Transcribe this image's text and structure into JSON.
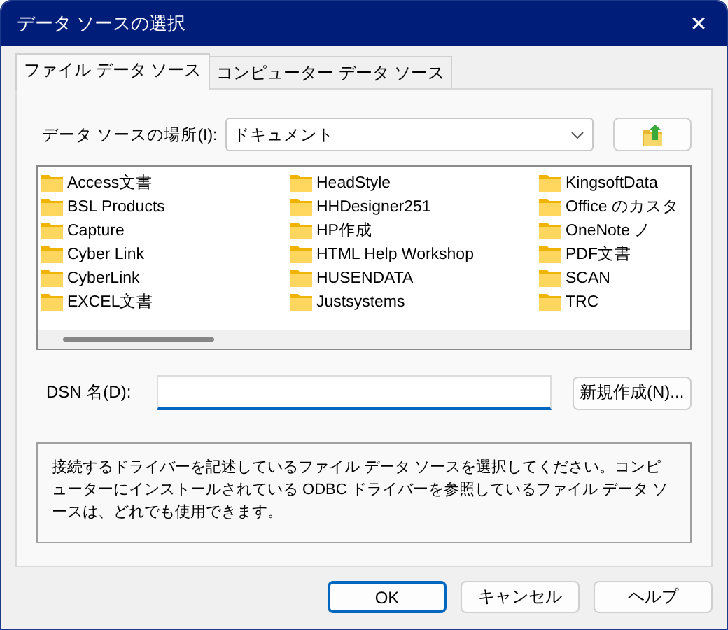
{
  "window": {
    "title": "データ ソースの選択",
    "close": "✕"
  },
  "tabs": [
    {
      "label": "ファイル データ ソース",
      "selected": true
    },
    {
      "label": "コンピューター データ ソース",
      "selected": false
    }
  ],
  "location": {
    "label": "データ ソースの場所(I):",
    "value": "ドキュメント"
  },
  "files": [
    {
      "name": "Access文書"
    },
    {
      "name": "BSL Products"
    },
    {
      "name": "Capture"
    },
    {
      "name": "Cyber Link"
    },
    {
      "name": "CyberLink"
    },
    {
      "name": "EXCEL文書"
    },
    {
      "name": "HeadStyle"
    },
    {
      "name": "HHDesigner251"
    },
    {
      "name": "HP作成"
    },
    {
      "name": "HTML Help Workshop"
    },
    {
      "name": "HUSENDATA"
    },
    {
      "name": "Justsystems"
    },
    {
      "name": "KingsoftData"
    },
    {
      "name": "Office のカスタ"
    },
    {
      "name": "OneNote ノ"
    },
    {
      "name": "PDF文書"
    },
    {
      "name": "SCAN"
    },
    {
      "name": "TRC"
    }
  ],
  "dsn": {
    "label": "DSN 名(D):"
  },
  "new_button": "新規作成(N)...",
  "description": "接続するドライバーを記述しているファイル データ ソースを選択してください。コンピューターにインストールされている ODBC ドライバーを参照しているファイル データ ソースは、どれでも使用できます。",
  "buttons": [
    {
      "label": "OK",
      "default": true
    },
    {
      "label": "キャンセル",
      "default": false
    },
    {
      "label": "ヘルプ",
      "default": false
    }
  ]
}
